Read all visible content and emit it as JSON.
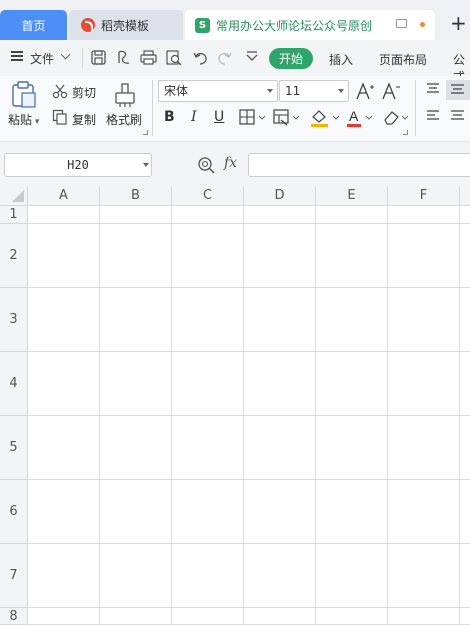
{
  "tabs": {
    "home": "首页",
    "template": "稻壳模板",
    "document": "常用办公大师论坛公众号原创",
    "doc_logo": "S",
    "new_tab": "+"
  },
  "menubar": {
    "file": "文件",
    "start": "开始",
    "insert": "插入",
    "page_layout": "页面布局",
    "formula": "公式"
  },
  "ribbon": {
    "paste": "粘贴",
    "cut": "剪切",
    "copy": "复制",
    "format_painter": "格式刷",
    "font_name": "宋体",
    "font_size": "11",
    "bold": "B",
    "italic": "I",
    "underline": "U",
    "font_color_letter": "A"
  },
  "formula_bar": {
    "cell_ref": "H20",
    "fx": "fx",
    "value": ""
  },
  "grid": {
    "columns": [
      "A",
      "B",
      "C",
      "D",
      "E",
      "F"
    ],
    "rows": [
      "1",
      "2",
      "3",
      "4",
      "5",
      "6",
      "7",
      "8"
    ]
  },
  "colors": {
    "home_tab": "#4d8ff6",
    "start_tab": "#2fa46b",
    "font_color_bar": "#e53935",
    "accent_dot": "#f08a2c"
  }
}
